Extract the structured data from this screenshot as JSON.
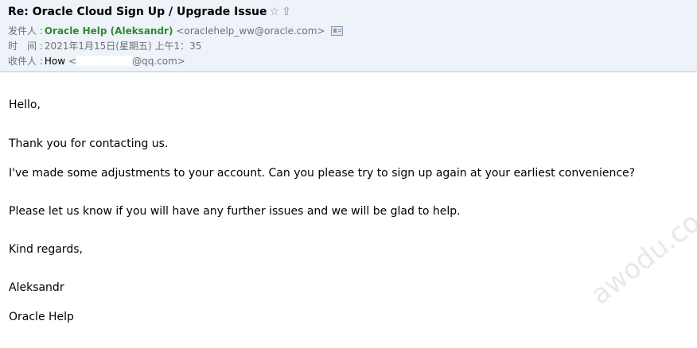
{
  "header": {
    "subject": "Re: Oracle Cloud Sign Up / Upgrade Issue",
    "star_icon": "star-outline-icon",
    "flag_icon": "up-arrow-icon",
    "from_label": "发件人 :",
    "from_name": "Oracle Help (Aleksandr)",
    "from_email": "<oraclehelp_ww@oracle.com>",
    "contact_icon": "contact-card-icon",
    "time_label": "时　间 :",
    "time_value": "2021年1月15日(星期五) 上午1：35",
    "to_label": "收件人 :",
    "to_name": "How",
    "to_email_prefix": "<",
    "to_email_suffix": "@qq.com>"
  },
  "body": {
    "greeting": "Hello,",
    "thanks": "Thank you for contacting us.",
    "para1": "I've made some adjustments to your account. Can you please try to sign up again at your earliest convenience?",
    "para2": "Please let us know if you will have any further issues and we will be glad to help.",
    "closing": "Kind regards,",
    "signature_name": "Aleksandr",
    "signature_org": "Oracle Help"
  },
  "watermark": "awodu.co",
  "colors": {
    "header_bg": "#eef3fa",
    "header_border": "#b9c8dc",
    "sender_green": "#2f8a2f",
    "meta_gray": "#6f6f6f"
  }
}
